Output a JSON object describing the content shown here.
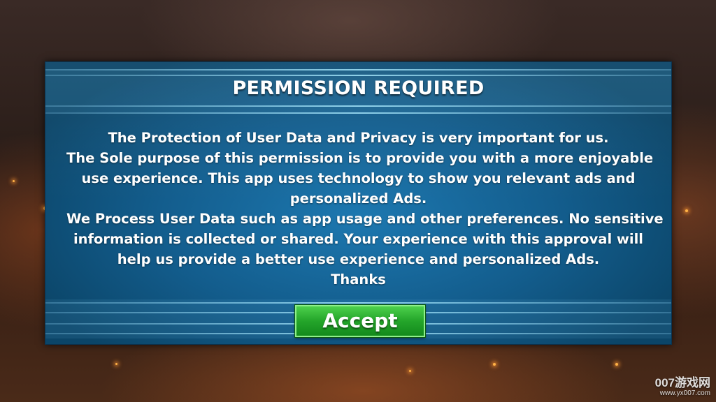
{
  "dialog": {
    "title": "PERMISSION REQUIRED",
    "lines": [
      "The Protection of User Data and Privacy is very important for us.",
      "The Sole purpose of this permission is to provide you with a more enjoyable",
      "use experience. This app uses technology to show you relevant ads and",
      "personalized Ads.",
      "We Process User Data such as app usage and other preferences. No sensitive",
      "information is collected or shared. Your experience with this approval will",
      "help us provide a better use experience  and personalized Ads.",
      "Thanks"
    ],
    "accept_label": "Accept"
  },
  "watermark": {
    "name": "007游戏网",
    "url": "www.yx007.com"
  },
  "colors": {
    "panel": "#135d8d",
    "accept_button": "#24a52a",
    "text": "#ffffff"
  }
}
